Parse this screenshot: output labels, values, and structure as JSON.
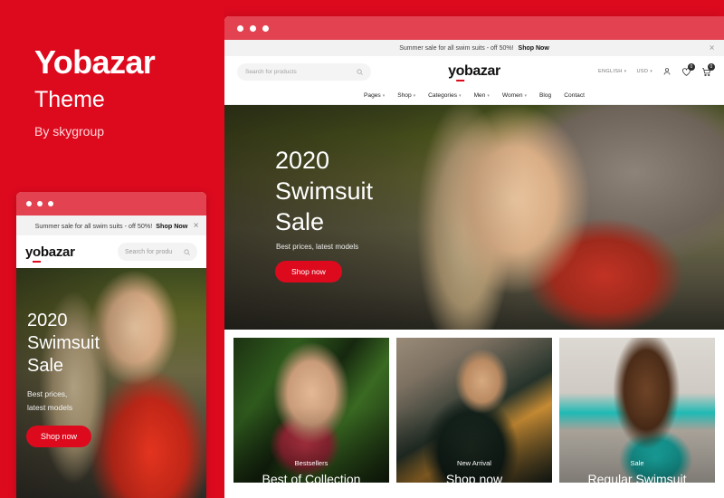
{
  "brand": {
    "title": "Yobazar",
    "subtitle": "Theme",
    "author": "By skygroup",
    "background_color": "#DD0A1E"
  },
  "announcement": {
    "text": "Summer sale for all swim suits - off 50%!",
    "cta": "Shop Now",
    "close_icon": "close-icon"
  },
  "desktop_preview": {
    "titlebar_color": "#E34251",
    "search": {
      "placeholder": "Search for products",
      "icon": "search-icon"
    },
    "logo": {
      "before": "y",
      "underlined": "o",
      "after": "bazar",
      "accent_color": "#DD0A1E"
    },
    "actions": {
      "language": "ENGLISH",
      "currency": "USD",
      "account_icon": "user-icon",
      "wishlist_icon": "heart-icon",
      "wishlist_count": "0",
      "cart_icon": "cart-icon",
      "cart_count": "0"
    },
    "nav": [
      {
        "label": "Pages",
        "has_dropdown": true
      },
      {
        "label": "Shop",
        "has_dropdown": true
      },
      {
        "label": "Categories",
        "has_dropdown": true
      },
      {
        "label": "Men",
        "has_dropdown": true
      },
      {
        "label": "Women",
        "has_dropdown": true
      },
      {
        "label": "Blog",
        "has_dropdown": false
      },
      {
        "label": "Contact",
        "has_dropdown": false
      }
    ],
    "hero": {
      "line1": "2020",
      "line2": "Swimsuit",
      "line3": "Sale",
      "subtitle": "Best prices, latest models",
      "button": "Shop now"
    },
    "cards": [
      {
        "caption": "Bestsellers",
        "title": "Best of Collection"
      },
      {
        "caption": "New Arrival",
        "title": "Shop now"
      },
      {
        "caption": "Sale",
        "title": "Regular Swimsuit"
      }
    ]
  },
  "mobile_preview": {
    "titlebar_color": "#E34251",
    "logo": {
      "before": "y",
      "underlined": "o",
      "after": "bazar"
    },
    "search": {
      "placeholder": "Search for produ",
      "icon": "search-icon"
    },
    "hero": {
      "line1": "2020",
      "line2": "Swimsuit",
      "line3": "Sale",
      "subtitle_line1": "Best prices,",
      "subtitle_line2": "latest models",
      "button": "Shop now"
    }
  }
}
